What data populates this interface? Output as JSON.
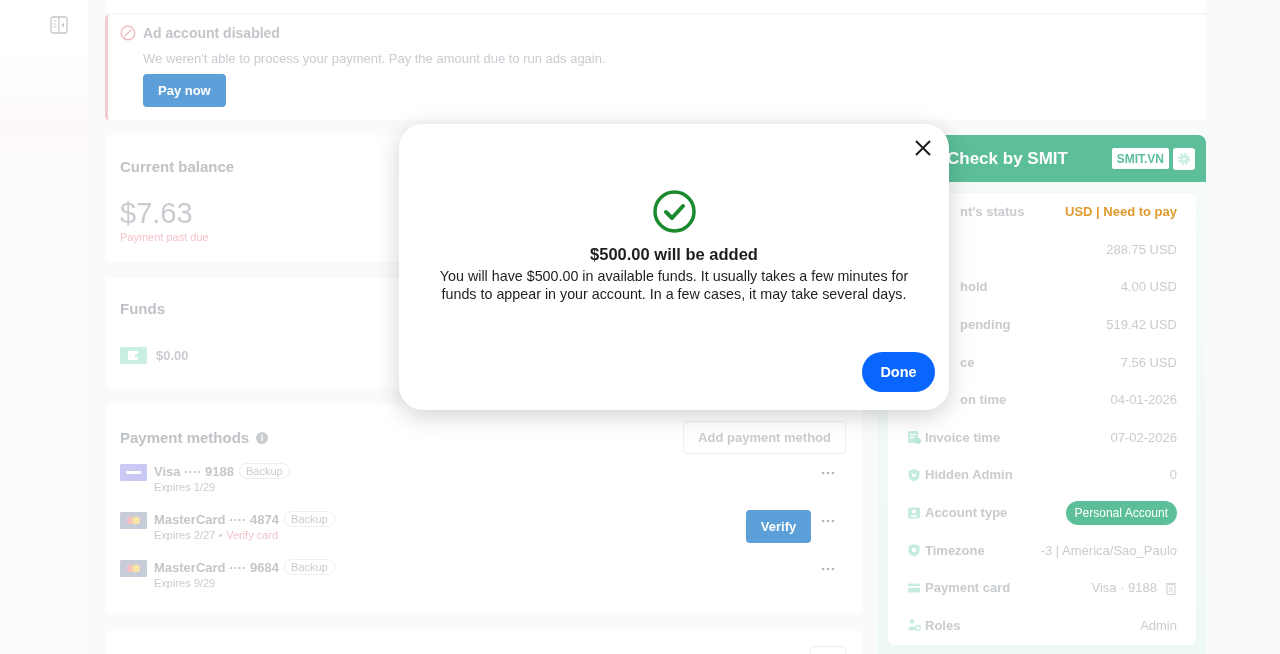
{
  "alert": {
    "title": "Ad account disabled",
    "message": "We weren't able to process your payment. Pay the amount due to run ads again.",
    "button": "Pay now"
  },
  "balance": {
    "title": "Current balance",
    "amount": "$7.63",
    "note": "Payment past due"
  },
  "funds": {
    "title": "Funds",
    "amount": "$0.00"
  },
  "payment_methods": {
    "title": "Payment methods",
    "add_button": "Add payment method",
    "methods": [
      {
        "kind": "visa",
        "name": "Visa ···· 9188",
        "badge": "Backup",
        "expires": "Expires 1/29"
      },
      {
        "kind": "mastercard",
        "name": "MasterCard ···· 4874",
        "badge": "Backup",
        "expires": "Expires 2/27",
        "warning": "Verify card",
        "action": "Verify"
      },
      {
        "kind": "mastercard",
        "name": "MasterCard ···· 9684",
        "badge": "Backup",
        "expires": "Expires 9/29"
      }
    ]
  },
  "smit_panel": {
    "title": "Check by SMIT",
    "link": "SMIT.VN",
    "rows": [
      {
        "kind": "status",
        "cut": true,
        "label": "nt's status",
        "value": "USD | Need to pay"
      },
      {
        "kind": "amount",
        "value": "288.75 USD"
      },
      {
        "kind": "amount",
        "cut": true,
        "label": "hold",
        "value": "4.00 USD"
      },
      {
        "kind": "amount",
        "cut": true,
        "label": "pending",
        "value": "519.42 USD"
      },
      {
        "kind": "amount",
        "cut": true,
        "label": "ce",
        "value": "7.56 USD"
      },
      {
        "kind": "date",
        "cut": true,
        "label": "on time",
        "value": "04-01-2026"
      },
      {
        "kind": "invoice",
        "cut": false,
        "label": "Invoice time",
        "value": "07-02-2026"
      },
      {
        "kind": "admin",
        "cut": false,
        "label": "Hidden Admin",
        "value": "0"
      },
      {
        "kind": "type",
        "cut": false,
        "label": "Account type",
        "value": "Personal Account"
      },
      {
        "kind": "timezone",
        "cut": false,
        "label": "Timezone",
        "value": "-3 | America/Sao_Paulo"
      },
      {
        "kind": "card",
        "cut": false,
        "label": "Payment card",
        "value": "Visa · 9188"
      },
      {
        "kind": "roles",
        "cut": false,
        "label": "Roles",
        "value": "Admin"
      }
    ]
  },
  "dialog": {
    "title": "$500.00 will be added",
    "message": "You will have $500.00 in available funds. It usually takes a few minutes for funds to appear in your account. In a few cases, it may take several days.",
    "button": "Done"
  }
}
